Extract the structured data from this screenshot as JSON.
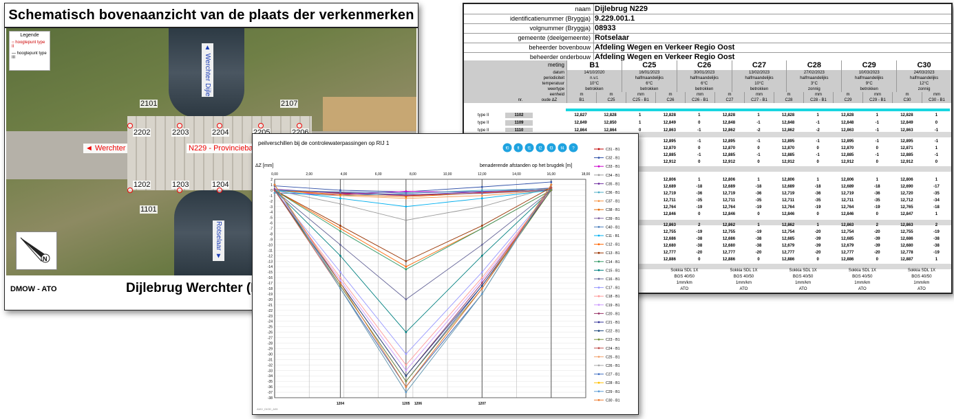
{
  "map": {
    "title": "Schematisch bovenaanzicht van de plaats der verkenmerken",
    "legend_title": "Legende",
    "legend_items": [
      "hoogtepunt type II",
      "hoogtepunt type III"
    ],
    "footer_left": "DMOW - ATO",
    "footer_right": "Dijlebrug Werchter (Ro",
    "labels": {
      "werchter": "Werchter",
      "n229": "N229 -  Provinciebaan",
      "werchter_dijle": "Werchter Dijle",
      "rotselaar": "Rotselaar"
    },
    "points": [
      "2101",
      "2107",
      "2202",
      "2203",
      "2204",
      "2205",
      "2206",
      "1202",
      "1203",
      "1204",
      "1101"
    ]
  },
  "table": {
    "info": [
      {
        "key": "naam",
        "value": "Dijlebrug N229"
      },
      {
        "key": "identificatienummer (Bryggja)",
        "value": "9.229.001.1"
      },
      {
        "key": "volgnummer (Bryggja)",
        "value": "08933"
      },
      {
        "key": "gemeente (deelgemeente)",
        "value": "Rotselaar"
      },
      {
        "key": "beheerder bovenbouw",
        "value": "Afdeling Wegen en Verkeer Regio Oost"
      },
      {
        "key": "beheerder onderbouw",
        "value": "Afdeling Wegen en Verkeer Regio Oost"
      }
    ],
    "meting_label": "meting",
    "measurements": [
      "B1",
      "C25",
      "C26",
      "C27",
      "C28",
      "C29",
      "C30"
    ],
    "rows": [
      {
        "key": "datum",
        "values": [
          "14/10/2020",
          "16/01/2023",
          "30/01/2023",
          "13/02/2023",
          "27/02/2023",
          "10/03/2023",
          "24/03/2023"
        ]
      },
      {
        "key": "periodiciteit",
        "values": [
          "n.v.t.",
          "halfmaandelijks",
          "halfmaandelijks",
          "halfmaandelijks",
          "halfmaandelijks",
          "halfmaandelijks",
          "halfmaandelijks"
        ]
      },
      {
        "key": "temperatuur",
        "values": [
          "10°C",
          "6°C",
          "6°C",
          "10°C",
          "3°C",
          "9°C",
          "12°C"
        ]
      },
      {
        "key": "weertype",
        "values": [
          "betrokken",
          "betrokken",
          "betrokken",
          "betrokken",
          "zonnig",
          "betrokken",
          "zonnig"
        ]
      },
      {
        "key": "eenheid",
        "values": [
          "m",
          "m",
          "mm",
          "m",
          "mm",
          "m",
          "mm",
          "m",
          "mm",
          "m",
          "mm",
          "m",
          "mm"
        ]
      }
    ],
    "col_headers": {
      "nr": "nr.",
      "oude": "oude ΔZ",
      "cols": [
        "B1",
        "C25",
        "C25 - B1",
        "C26",
        "C26 - B1",
        "C27",
        "C27 - B1",
        "C28",
        "C28 - B1",
        "C29",
        "C29 - B1",
        "C30",
        "C30 - B1"
      ]
    },
    "type_rows": [
      {
        "type": "type II",
        "nr": "1102",
        "cells": [
          "12,827",
          "12,828",
          "1",
          "12,828",
          "1",
          "12,828",
          "1",
          "12,828",
          "1",
          "12,828",
          "1",
          "12,828",
          "1"
        ]
      },
      {
        "type": "type II",
        "nr": "1109",
        "cells": [
          "12,849",
          "12,850",
          "1",
          "12,849",
          "0",
          "12,848",
          "-1",
          "12,848",
          "-1",
          "12,848",
          "-1",
          "12,849",
          "0"
        ]
      },
      {
        "type": "type II",
        "nr": "1110",
        "cells": [
          "12,864",
          "12,864",
          "0",
          "12,863",
          "-1",
          "12,862",
          "-2",
          "12,862",
          "-2",
          "12,863",
          "-1",
          "12,863",
          "-1"
        ]
      }
    ],
    "block2": [
      [
        "12,895",
        "-1",
        "12,895",
        "-1",
        "12,895",
        "-1",
        "12,895",
        "-1",
        "12,895",
        "-1"
      ],
      [
        "12,870",
        "0",
        "12,870",
        "0",
        "12,870",
        "0",
        "12,870",
        "0",
        "12,871",
        "1"
      ],
      [
        "12,885",
        "-1",
        "12,885",
        "-1",
        "12,885",
        "-1",
        "12,885",
        "-1",
        "12,885",
        "-1"
      ],
      [
        "12,912",
        "0",
        "12,912",
        "0",
        "12,912",
        "0",
        "12,912",
        "0",
        "12,912",
        "0"
      ]
    ],
    "block3": [
      [
        "12,806",
        "1",
        "12,806",
        "1",
        "12,806",
        "1",
        "12,806",
        "1",
        "12,806",
        "1"
      ],
      [
        "12,689",
        "-18",
        "12,689",
        "-18",
        "12,689",
        "-18",
        "12,689",
        "-18",
        "12,690",
        "-17"
      ],
      [
        "12,719",
        "-36",
        "12,719",
        "-36",
        "12,719",
        "-36",
        "12,719",
        "-36",
        "12,720",
        "-35"
      ],
      [
        "12,711",
        "-35",
        "12,711",
        "-35",
        "12,711",
        "-35",
        "12,711",
        "-35",
        "12,712",
        "-34"
      ],
      [
        "12,764",
        "-19",
        "12,764",
        "-19",
        "12,764",
        "-19",
        "12,764",
        "-19",
        "12,765",
        "-18"
      ],
      [
        "12,846",
        "0",
        "12,846",
        "0",
        "12,846",
        "0",
        "12,846",
        "0",
        "12,847",
        "1"
      ]
    ],
    "block4": [
      [
        "12,863",
        "2",
        "12,862",
        "1",
        "12,862",
        "1",
        "12,863",
        "2",
        "12,863",
        "2"
      ],
      [
        "12,755",
        "-19",
        "12,755",
        "-19",
        "12,754",
        "-20",
        "12,754",
        "-20",
        "12,755",
        "-19"
      ],
      [
        "12,686",
        "-38",
        "12,686",
        "-38",
        "12,685",
        "-39",
        "12,685",
        "-39",
        "12,686",
        "-38"
      ],
      [
        "12,680",
        "-38",
        "12,680",
        "-38",
        "12,679",
        "-39",
        "12,679",
        "-39",
        "12,680",
        "-38"
      ],
      [
        "12,777",
        "-20",
        "12,777",
        "-20",
        "12,777",
        "-20",
        "12,777",
        "-20",
        "12,778",
        "-19"
      ],
      [
        "12,886",
        "0",
        "12,886",
        "0",
        "12,886",
        "0",
        "12,886",
        "0",
        "12,887",
        "1"
      ]
    ],
    "instrument_rows": [
      [
        "Sokkia SDL 1X",
        "Sokkia SDL 1X",
        "Sokkia SDL 1X",
        "Sokkia SDL 1X",
        "Sokkia SDL 1X"
      ],
      [
        "BGS 40/50",
        "BGS 40/50",
        "BGS 40/50",
        "BGS 40/50",
        "BGS 40/50"
      ],
      [
        "1mm/km",
        "1mm/km",
        "1mm/km",
        "1mm/km",
        "1mm/km"
      ],
      [
        "ATO",
        "ATO",
        "ATO",
        "ATO",
        "ATO"
      ]
    ]
  },
  "chart_panel": {
    "footer_note": "AWV_DIOD_A99",
    "buttons": [
      "f0",
      "fl",
      "f1",
      "f2",
      "f3",
      "f4",
      "?"
    ],
    "button_color": "#1fa3e0"
  },
  "chart_data": {
    "type": "line",
    "title": "peilverschillen bij de controlewaterpassingen op RIJ 1",
    "ylabel": "ΔZ [mm]",
    "xlabel": "benaderende afstanden op het brugdek [m]",
    "x_ticks": [
      "0,00",
      "2,00",
      "4,00",
      "6,00",
      "8,00",
      "10,00",
      "12,00",
      "14,00",
      "16,00",
      "18,00"
    ],
    "xlim": [
      0,
      18
    ],
    "ylim": [
      -38,
      2
    ],
    "y_tick_step": 1,
    "grid": true,
    "legend_position": "right",
    "point_labels": [
      {
        "x": 3.8,
        "text": "1204"
      },
      {
        "x": 7.6,
        "text": "1205"
      },
      {
        "x": 8.3,
        "text": "1206"
      },
      {
        "x": 12.0,
        "text": "1207"
      }
    ],
    "x": [
      0,
      3.8,
      7.6,
      12.0,
      16.0
    ],
    "series": [
      {
        "name": "C31 - B1",
        "color": "#c00000",
        "values": [
          0,
          -0.5,
          -1,
          -0.5,
          0
        ]
      },
      {
        "name": "C32 - B1",
        "color": "#2e4fa8",
        "values": [
          0.8,
          0,
          -0.3,
          0.6,
          1.5
        ]
      },
      {
        "name": "C33 - B1",
        "color": "#cc00cc",
        "values": [
          -0.5,
          -0.8,
          -0.2,
          -0.4,
          0.2
        ]
      },
      {
        "name": "C34 - B1",
        "color": "#9b9b9b",
        "values": [
          0,
          -2.5,
          -5.5,
          -3,
          0.5
        ]
      },
      {
        "name": "C35 - B1",
        "color": "#7030a0",
        "values": [
          0.2,
          -0.6,
          -0.9,
          -0.3,
          0.4
        ]
      },
      {
        "name": "C36 - B1",
        "color": "#4bacc6",
        "values": [
          -0.5,
          -1,
          -0.6,
          0,
          0.3
        ]
      },
      {
        "name": "C37 - B1",
        "color": "#f79646",
        "values": [
          0,
          -1,
          -1.5,
          -1,
          0
        ]
      },
      {
        "name": "C38 - B1",
        "color": "#e26b0a",
        "values": [
          0,
          -0.8,
          -1.2,
          -0.5,
          0.2
        ]
      },
      {
        "name": "C39 - B1",
        "color": "#8064a2",
        "values": [
          0,
          -0.4,
          -0.8,
          -0.6,
          0
        ]
      },
      {
        "name": "C40 - B1",
        "color": "#4f81bd",
        "values": [
          0,
          -0.3,
          -0.5,
          -0.2,
          0.1
        ]
      },
      {
        "name": "C11 - B1",
        "color": "#00b0f0",
        "values": [
          0,
          -1.5,
          -3,
          -1.5,
          0
        ]
      },
      {
        "name": "C12 - B1",
        "color": "#ff6600",
        "values": [
          0,
          -7,
          -14,
          -7,
          0
        ]
      },
      {
        "name": "C13 - B1",
        "color": "#993300",
        "values": [
          0,
          -6.5,
          -13,
          -6.5,
          0.5
        ]
      },
      {
        "name": "C14 - B1",
        "color": "#339966",
        "values": [
          0,
          -7.5,
          -14.5,
          -7,
          0
        ]
      },
      {
        "name": "C15 - B1",
        "color": "#008080",
        "values": [
          0,
          -12,
          -26,
          -12,
          0
        ]
      },
      {
        "name": "C16 - B1",
        "color": "#666699",
        "values": [
          0,
          -10,
          -20,
          -10,
          0
        ]
      },
      {
        "name": "C17 - B1",
        "color": "#9999ff",
        "values": [
          0,
          -15,
          -30,
          -15,
          0
        ]
      },
      {
        "name": "C18 - B1",
        "color": "#ff9999",
        "values": [
          0,
          -16,
          -32,
          -16,
          0
        ]
      },
      {
        "name": "C19 - B1",
        "color": "#cc99ff",
        "values": [
          0,
          -16.5,
          -33,
          -16.5,
          0
        ]
      },
      {
        "name": "C20 - B1",
        "color": "#993366",
        "values": [
          0,
          -17,
          -34,
          -17,
          0
        ]
      },
      {
        "name": "C21 - B1",
        "color": "#333399",
        "values": [
          0,
          -17.5,
          -35,
          -17.5,
          0
        ]
      },
      {
        "name": "C22 - B1",
        "color": "#1f497d",
        "values": [
          0,
          -17,
          -34,
          -17.5,
          0
        ]
      },
      {
        "name": "C23 - B1",
        "color": "#76923c",
        "values": [
          0,
          -17.5,
          -35,
          -18,
          0
        ]
      },
      {
        "name": "C24 - B1",
        "color": "#c0504d",
        "values": [
          0,
          -18,
          -36,
          -18,
          0.5
        ]
      },
      {
        "name": "C25 - B1",
        "color": "#f2a36e",
        "values": [
          1,
          -18,
          -36,
          -19,
          1
        ]
      },
      {
        "name": "C26 - B1",
        "color": "#a5a5a5",
        "values": [
          1,
          -18,
          -36,
          -19,
          1
        ]
      },
      {
        "name": "C27 - B1",
        "color": "#4472c4",
        "values": [
          1,
          -18,
          -36,
          -19,
          1
        ]
      },
      {
        "name": "C28 - B1",
        "color": "#ffc000",
        "values": [
          1,
          -18,
          -37,
          -19,
          1
        ]
      },
      {
        "name": "C29 - B1",
        "color": "#5b9bd5",
        "values": [
          1,
          -18,
          -37,
          -19,
          1
        ]
      },
      {
        "name": "C30 - B1",
        "color": "#ed7d31",
        "values": [
          1,
          -17,
          -36,
          -18,
          1
        ]
      }
    ]
  }
}
